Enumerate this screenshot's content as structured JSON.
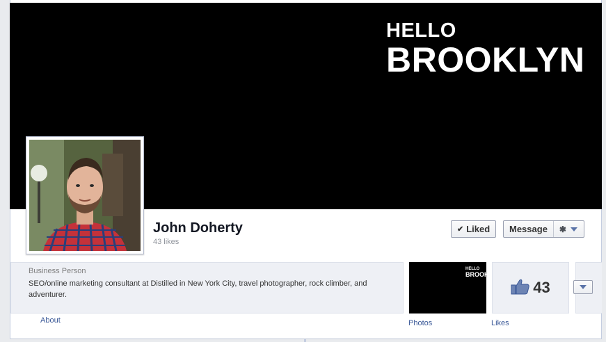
{
  "cover": {
    "line1": "HELLO",
    "line2": "BROOKLYN",
    "background": "#000000",
    "text_color": "#ffffff"
  },
  "profile": {
    "name": "John Doherty",
    "likes": "43 likes"
  },
  "actions": {
    "liked_label": "Liked",
    "message_label": "Message"
  },
  "info": {
    "category": "Business Person",
    "description": "SEO/online marketing consultant at Distilled in New York City, travel photographer, rock climber, and adventurer."
  },
  "apps": {
    "about_label": "About",
    "photos_label": "Photos",
    "photos_thumb_line1": "HELLO",
    "photos_thumb_line2": "BROOK",
    "likes_label": "Likes",
    "likes_number": "43"
  },
  "colors": {
    "link": "#3b5998",
    "name": "#141823",
    "panel": "#eef0f5"
  }
}
